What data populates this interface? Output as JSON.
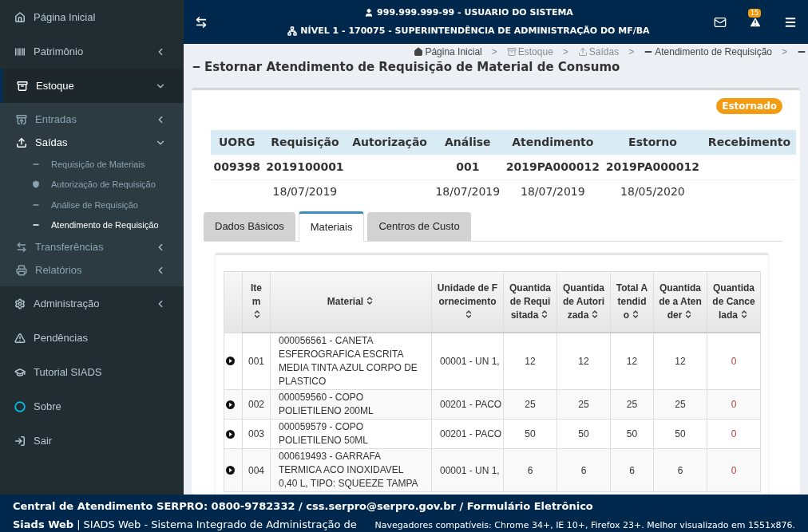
{
  "sidebar": {
    "items": [
      {
        "label": "Página Inicial",
        "selected": false
      },
      {
        "label": "Patrimônio",
        "selected": false,
        "expanded": false
      },
      {
        "label": "Estoque",
        "selected": true,
        "expanded": true,
        "children": [
          {
            "label": "Entradas",
            "selected": false,
            "expanded": false
          },
          {
            "label": "Saídas",
            "selected": true,
            "expanded": true,
            "children": [
              {
                "label": "Requisição de Materiais",
                "selected": false
              },
              {
                "label": "Autorização de Requisição",
                "selected": false
              },
              {
                "label": "Análise de Requisição",
                "selected": false
              },
              {
                "label": "Atendimento de Requisição",
                "selected": true
              }
            ]
          },
          {
            "label": "Transferências",
            "selected": false,
            "expanded": false
          },
          {
            "label": "Relatórios",
            "selected": false,
            "expanded": false
          }
        ]
      },
      {
        "label": "Administração",
        "selected": false,
        "expanded": false
      },
      {
        "label": "Pendências",
        "selected": false
      },
      {
        "label": "Tutorial SIADS",
        "selected": false
      },
      {
        "label": "Sobre",
        "selected": false
      },
      {
        "label": "Sair",
        "selected": false
      }
    ]
  },
  "header": {
    "user": "999.999.999-99 - USUARIO DO SISTEMA",
    "level": "NÍVEL 1 - 170075 - SUPERINTENDÊNCIA DE ADMINISTRAÇÃO DO MF/BA",
    "alerts_badge": "15"
  },
  "breadcrumb": [
    {
      "label": "Página Inicial",
      "disabled": false
    },
    {
      "label": "Estoque",
      "disabled": true
    },
    {
      "label": "Saídas",
      "disabled": true
    },
    {
      "label": "Atendimento de Requisição",
      "disabled": false
    }
  ],
  "breadcrumb_separator": ">",
  "page_title": "Estornar Atendimento de Requisição de Material de Consumo",
  "status_badge": "Estornado",
  "summary": {
    "columns": [
      {
        "label": "UORG",
        "code": "009398"
      },
      {
        "label": "Requisição",
        "code": "2019100001",
        "date": "18/07/2019"
      },
      {
        "label": "Autorização"
      },
      {
        "label": "Análise",
        "code": "001",
        "date": "18/07/2019"
      },
      {
        "label": "Atendimento",
        "code": "2019PA000012",
        "date": "18/07/2019"
      },
      {
        "label": "Estorno",
        "code": "2019PA000012",
        "date": "18/05/2020"
      },
      {
        "label": "Recebimento"
      }
    ]
  },
  "tabs": [
    {
      "label": "Dados Básicos",
      "selected": false
    },
    {
      "label": "Materiais",
      "selected": true
    },
    {
      "label": "Centros de Custo",
      "selected": false
    }
  ],
  "table": {
    "columns": [
      "Item",
      "Material",
      "Unidade de Fornecimento",
      "Quantidade Requisitada",
      "Quantidade Autorizada",
      "Total Atendido",
      "Quantidade a Atender",
      "Quantidade Cancelada"
    ],
    "rows": [
      {
        "item": "001",
        "material": "000056561 - CANETA ESFEROGRAFICA ESCRITA MEDIA TINTA AZUL CORPO DE PLASTICO",
        "unit": "00001 - UN 1,",
        "requested": "12",
        "authorized": "12",
        "served": "12",
        "to_serve": "12",
        "cancelled": "0"
      },
      {
        "item": "002",
        "material": "000059560 - COPO POLIETILENO 200ML",
        "unit": "00201 - PACO",
        "requested": "25",
        "authorized": "25",
        "served": "25",
        "to_serve": "25",
        "cancelled": "0"
      },
      {
        "item": "003",
        "material": "000059579 - COPO POLIETILENO 50ML",
        "unit": "00201 - PACO",
        "requested": "50",
        "authorized": "50",
        "served": "50",
        "to_serve": "50",
        "cancelled": "0"
      },
      {
        "item": "004",
        "material": "000619493 - GARRAFA TERMICA ACO INOXIDAVEL 0,40 L, TIPO: SQUEEZE TAMPA",
        "unit": "00001 - UN 1,",
        "requested": "6",
        "authorized": "6",
        "served": "6",
        "to_serve": "6",
        "cancelled": "0"
      }
    ]
  },
  "footer": {
    "contact": "Central de Atendimento SERPRO: 0800-9782332 / css.serpro@serpro.gov.br / Formulário Eletrônico",
    "app_name": "Siads Web",
    "app_separator": "|",
    "app_description": "SIADS Web - Sistema Integrado de Administração de",
    "browsers": "Navegadores compatíveis: Chrome 34+, IE 10+, Firefox 23+. Melhor visualizado em 1551x876."
  }
}
